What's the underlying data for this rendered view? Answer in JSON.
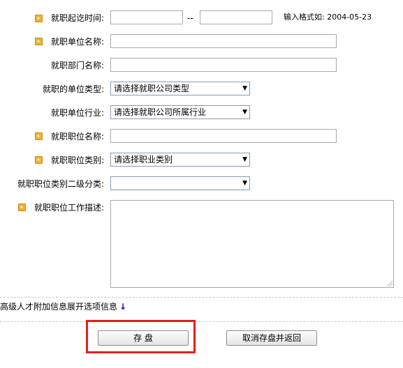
{
  "form": {
    "start_date": {
      "label": "就职起讫时间:",
      "separator": "--",
      "hint": "输入格式如: 2004-05-23",
      "required": true
    },
    "company_name": {
      "label": "就职单位名称:",
      "required": true
    },
    "department": {
      "label": "就职部门名称:",
      "required": false
    },
    "company_type": {
      "label": "就职的单位类型:",
      "selected": "请选择就职公司类型"
    },
    "industry": {
      "label": "就职单位行业:",
      "selected": "请选择就职公司所属行业"
    },
    "position_name": {
      "label": "就职职位名称:",
      "required": true
    },
    "position_category": {
      "label": "就职职位类别:",
      "selected": "请选择职业类别",
      "required": true
    },
    "position_subcategory": {
      "label": "就职职位类别二级分类:",
      "selected": ""
    },
    "job_description": {
      "label": "就职职位工作描述:",
      "required": true
    }
  },
  "extra": {
    "prefix": "高级人才附加信息",
    "expand_link": "展开选项信息",
    "arrow": "↓"
  },
  "buttons": {
    "save": "存 盘",
    "cancel": "取消存盘并返回"
  },
  "colors": {
    "required_icon": "#ecb33a",
    "highlight": "#e02020",
    "link": "#0000cc"
  },
  "icons": {
    "required": "required-marker-icon",
    "select_arrow": "dropdown-arrow-icon"
  },
  "glyphs": {
    "required": "▸",
    "dropdown": "▼"
  }
}
